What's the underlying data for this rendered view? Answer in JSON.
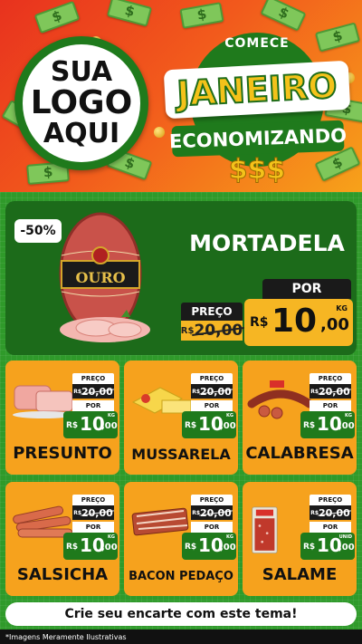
{
  "header": {
    "logo_lines": [
      "SUA",
      "LOGO",
      "AQUI"
    ],
    "campaign_top": "COMECE",
    "campaign_main": "JANEIRO",
    "campaign_sub": "ECONOMIZANDO",
    "campaign_money": "$$$"
  },
  "featured": {
    "discount": "-50%",
    "brand_label": "OURO",
    "name": "MORTADELA",
    "old_price_label": "PREÇO",
    "old_price_currency": "R$",
    "old_price": "20,00",
    "new_price_label": "POR",
    "new_price_currency": "R$",
    "new_price_int": "10",
    "new_price_dec": ",00",
    "unit": "KG"
  },
  "products": [
    {
      "name": "PRESUNTO",
      "old_label": "PREÇO",
      "old_currency": "R$",
      "old_price": "20,00",
      "new_label": "POR",
      "currency": "R$",
      "price_int": "10",
      "price_dec": ",00",
      "unit": "KG"
    },
    {
      "name": "MUSSARELA",
      "old_label": "PREÇO",
      "old_currency": "R$",
      "old_price": "20,00",
      "new_label": "POR",
      "currency": "R$",
      "price_int": "10",
      "price_dec": ",00",
      "unit": "KG"
    },
    {
      "name": "CALABRESA",
      "old_label": "PREÇO",
      "old_currency": "R$",
      "old_price": "20,00",
      "new_label": "POR",
      "currency": "R$",
      "price_int": "10",
      "price_dec": ",00",
      "unit": "KG"
    },
    {
      "name": "SALSICHA",
      "old_label": "PREÇO",
      "old_currency": "R$",
      "old_price": "20,00",
      "new_label": "POR",
      "currency": "R$",
      "price_int": "10",
      "price_dec": ",00",
      "unit": "KG"
    },
    {
      "name": "BACON PEDAÇO",
      "old_label": "PREÇO",
      "old_currency": "R$",
      "old_price": "20,00",
      "new_label": "POR",
      "currency": "R$",
      "price_int": "10",
      "price_dec": ",00",
      "unit": "KG"
    },
    {
      "name": "SALAME",
      "old_label": "PREÇO",
      "old_currency": "R$",
      "old_price": "20,00",
      "new_label": "POR",
      "currency": "R$",
      "price_int": "10",
      "price_dec": ",00",
      "unit": "UNID"
    }
  ],
  "footer": {
    "cta": "Crie seu encarte com este tema!",
    "disclaimer": "*Imagens Meramente Ilustrativas"
  },
  "colors": {
    "header_red": "#e8321e",
    "header_orange": "#f7a21a",
    "green_dark": "#1c6b1a",
    "green_bg": "#2f9a2a",
    "card_orange": "#f6a21d",
    "price_yellow": "#f6b623"
  }
}
